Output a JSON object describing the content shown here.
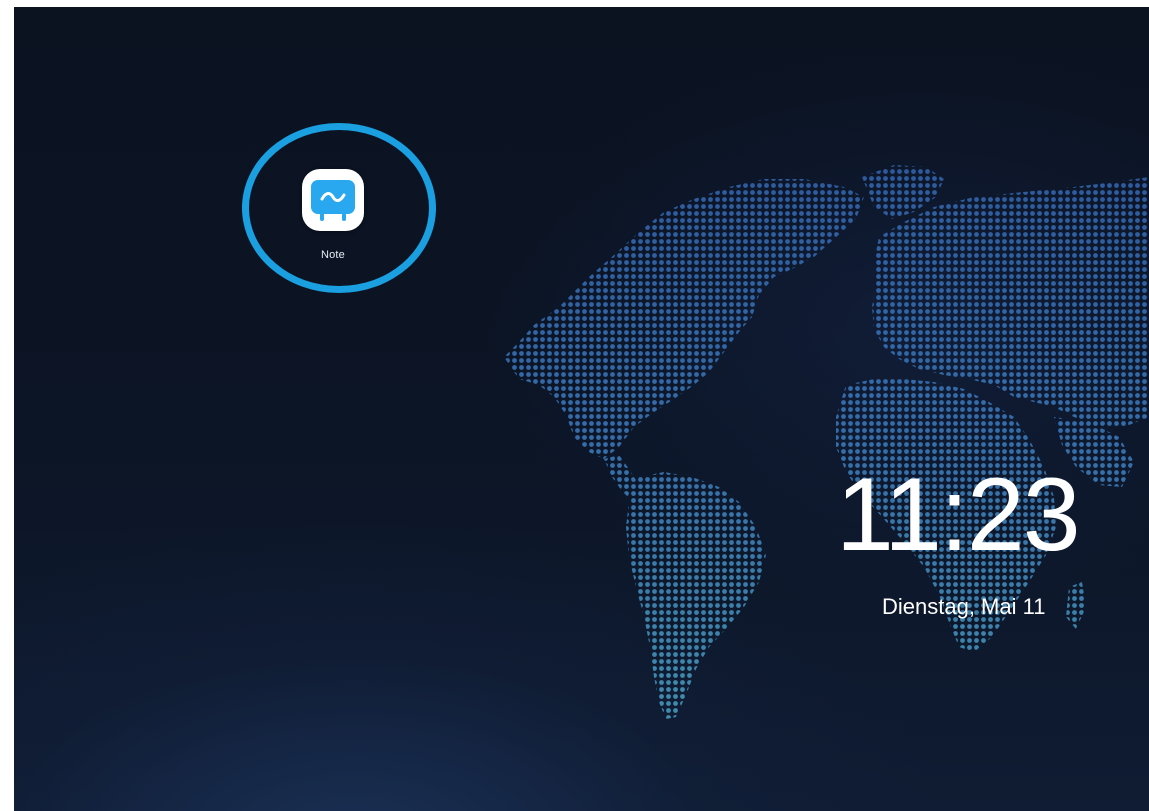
{
  "desktop": {
    "apps": [
      {
        "label": "Note",
        "icon": "note-board-icon"
      }
    ],
    "highlight_color": "#1a9fe0"
  },
  "lock_clock": {
    "time": "11:23",
    "date": "Dienstag, Mai 11"
  },
  "wallpaper": {
    "description_icon": "dotted-world-map",
    "base_color": "#0b1220",
    "map_color_top": "#2d5aa0",
    "map_color_bottom": "#4a9cb8"
  }
}
